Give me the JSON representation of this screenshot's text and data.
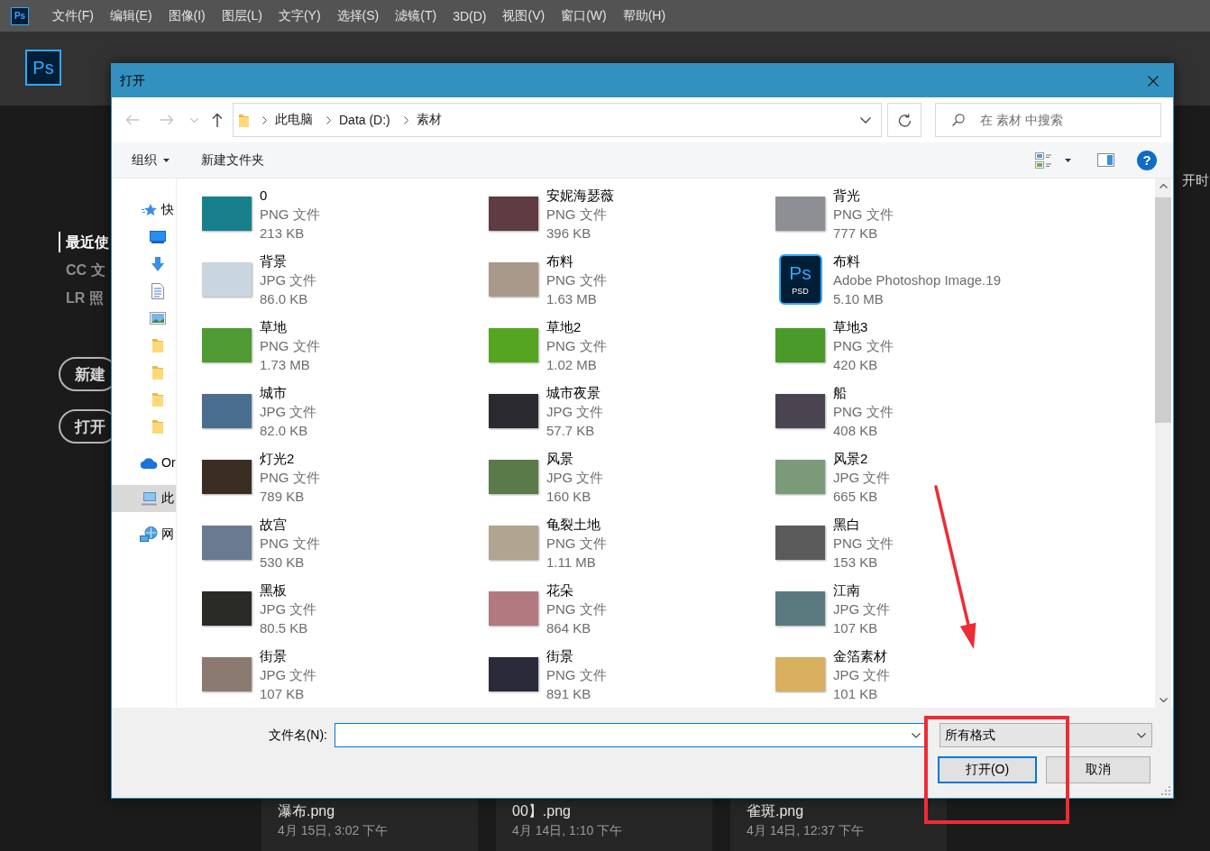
{
  "app": {
    "menu_logo": "Ps",
    "menu": [
      "文件(F)",
      "编辑(E)",
      "图像(I)",
      "图层(L)",
      "文字(Y)",
      "选择(S)",
      "滤镜(T)",
      "3D(D)",
      "视图(V)",
      "窗口(W)",
      "帮助(H)"
    ],
    "logo": "Ps",
    "sidebar": {
      "items": [
        {
          "label": "最近使",
          "selected": true
        },
        {
          "label": "CC 文",
          "selected": false
        },
        {
          "label": "LR 照",
          "selected": false
        }
      ],
      "buttons": [
        "新建",
        "打开"
      ]
    },
    "heading": "开时",
    "recent": [
      {
        "name": "瀑布.png",
        "date": "4月 15日, 3:02 下午"
      },
      {
        "name": "00】.png",
        "date": "4月 14日, 1:10 下午"
      },
      {
        "name": "雀斑.png",
        "date": "4月 14日, 12:37 下午"
      }
    ]
  },
  "dialog": {
    "title": "打开",
    "history": [
      {
        "kind": "back",
        "disabled": true
      },
      {
        "kind": "forward",
        "disabled": true
      },
      {
        "kind": "recent",
        "disabled": true
      },
      {
        "kind": "up",
        "disabled": false
      }
    ],
    "address": {
      "crumbs": [
        "此电脑",
        "Data (D:)",
        "素材"
      ]
    },
    "search": {
      "placeholder": "在 素材 中搜索"
    },
    "toolbar": {
      "organize": "组织",
      "new_folder": "新建文件夹",
      "help": "?"
    },
    "nav": [
      {
        "kind": "star",
        "label": "快",
        "selected": false,
        "children": [
          {
            "kind": "desktop",
            "selected": false
          },
          {
            "kind": "download",
            "selected": false
          },
          {
            "kind": "document",
            "selected": false
          },
          {
            "kind": "pictures",
            "selected": false
          },
          {
            "kind": "folder",
            "selected": false
          },
          {
            "kind": "folder",
            "selected": false
          },
          {
            "kind": "folder",
            "selected": false
          },
          {
            "kind": "folder",
            "selected": false
          }
        ]
      },
      {
        "kind": "cloud",
        "label": "Or",
        "selected": false
      },
      {
        "kind": "computer",
        "label": "此",
        "selected": true
      },
      {
        "kind": "globe",
        "label": "网",
        "selected": false
      }
    ],
    "files": [
      {
        "name": "0",
        "type": "PNG 文件",
        "size": "213 KB",
        "kind": "photo",
        "color": "#17808c"
      },
      {
        "name": "安妮海瑟薇",
        "type": "PNG 文件",
        "size": "396 KB",
        "kind": "photo",
        "color": "#5e3c42"
      },
      {
        "name": "背光",
        "type": "PNG 文件",
        "size": "777 KB",
        "kind": "photo",
        "color": "#8d8f95"
      },
      {
        "name": "背景",
        "type": "JPG 文件",
        "size": "86.0 KB",
        "kind": "photo",
        "color": "#c9d6df"
      },
      {
        "name": "布料",
        "type": "PNG 文件",
        "size": "1.63 MB",
        "kind": "photo",
        "color": "#a8998a"
      },
      {
        "name": "布料",
        "type": "Adobe Photoshop Image.19",
        "size": "5.10 MB",
        "kind": "psd",
        "icon_text": "Ps",
        "icon_badge": "PSD"
      },
      {
        "name": "草地",
        "type": "PNG 文件",
        "size": "1.73 MB",
        "kind": "photo",
        "color": "#4f9a32"
      },
      {
        "name": "草地2",
        "type": "PNG 文件",
        "size": "1.02 MB",
        "kind": "photo",
        "color": "#56a520"
      },
      {
        "name": "草地3",
        "type": "PNG 文件",
        "size": "420 KB",
        "kind": "photo",
        "color": "#4a9a2a"
      },
      {
        "name": "城市",
        "type": "JPG 文件",
        "size": "82.0 KB",
        "kind": "photo",
        "color": "#4a6f8e"
      },
      {
        "name": "城市夜景",
        "type": "JPG 文件",
        "size": "57.7 KB",
        "kind": "photo",
        "color": "#2a2a30"
      },
      {
        "name": "船",
        "type": "PNG 文件",
        "size": "408 KB",
        "kind": "photo",
        "color": "#4a4450"
      },
      {
        "name": "灯光2",
        "type": "PNG 文件",
        "size": "789 KB",
        "kind": "photo",
        "color": "#3a2e22"
      },
      {
        "name": "风景",
        "type": "JPG 文件",
        "size": "160 KB",
        "kind": "photo",
        "color": "#5a7a4a"
      },
      {
        "name": "风景2",
        "type": "JPG 文件",
        "size": "665 KB",
        "kind": "photo",
        "color": "#7a9a7a"
      },
      {
        "name": "故宫",
        "type": "PNG 文件",
        "size": "530 KB",
        "kind": "photo",
        "color": "#6a7a90"
      },
      {
        "name": "龟裂土地",
        "type": "PNG 文件",
        "size": "1.11 MB",
        "kind": "photo",
        "color": "#b0a590"
      },
      {
        "name": "黑白",
        "type": "PNG 文件",
        "size": "153 KB",
        "kind": "photo",
        "color": "#5a5a5a"
      },
      {
        "name": "黑板",
        "type": "JPG 文件",
        "size": "80.5 KB",
        "kind": "photo",
        "color": "#2a2a26"
      },
      {
        "name": "花朵",
        "type": "PNG 文件",
        "size": "864 KB",
        "kind": "photo",
        "color": "#b07a80"
      },
      {
        "name": "江南",
        "type": "JPG 文件",
        "size": "107 KB",
        "kind": "photo",
        "color": "#5a7a80"
      },
      {
        "name": "街景",
        "type": "JPG 文件",
        "size": "107 KB",
        "kind": "photo",
        "color": "#8a7a70"
      },
      {
        "name": "街景",
        "type": "PNG 文件",
        "size": "891 KB",
        "kind": "photo",
        "color": "#2a2a3a"
      },
      {
        "name": "金箔素材",
        "type": "JPG 文件",
        "size": "101 KB",
        "kind": "photo",
        "color": "#d8b060"
      }
    ],
    "file_name": {
      "label": "文件名(N):",
      "focused": true
    },
    "filter": {
      "value": "所有格式"
    },
    "buttons": [
      {
        "label": "打开(O)",
        "default": true
      },
      {
        "label": "取消",
        "default": false
      }
    ]
  }
}
